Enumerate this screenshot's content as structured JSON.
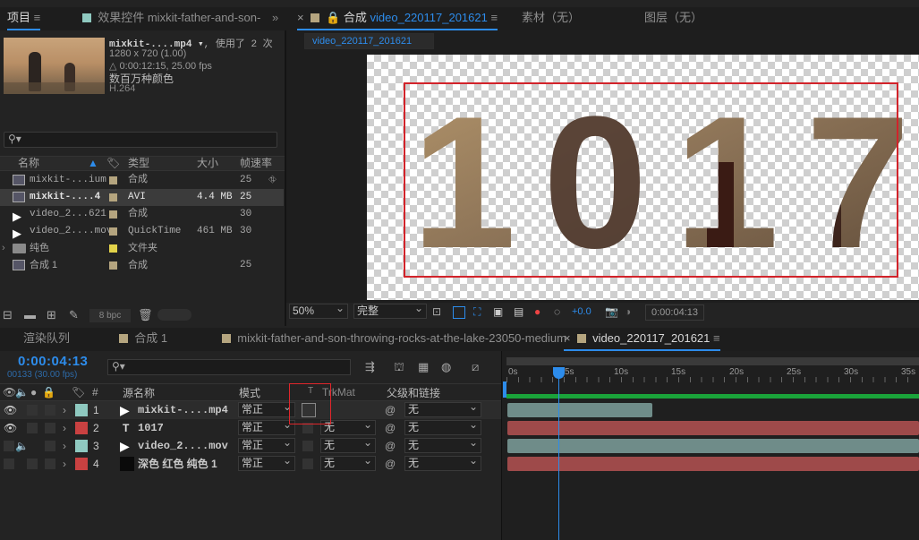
{
  "top_tabs": {
    "project": "项目",
    "effects": "效果控件 mixkit-father-and-son-",
    "comp_prefix": "合成",
    "comp_name": "video_220117_201621",
    "footage": "素材（无）",
    "layer": "图层（无）"
  },
  "project": {
    "thumb_name": "mixkit-....mp4 ▾",
    "used": ", 使用了 2 次",
    "resolution": "1280 x 720 (1.00)",
    "duration": "△ 0:00:12:15, 25.00 fps",
    "colors": "数百万种颜色",
    "codec": "H.264",
    "search_placeholder": "",
    "columns": {
      "name": "名称",
      "type": "类型",
      "size": "大小",
      "fps": "帧速率"
    },
    "items": [
      {
        "name": "mixkit-...ium",
        "type": "合成",
        "size": "",
        "fps": "25",
        "icon": "composition-icon",
        "color": "#b5a57f"
      },
      {
        "name": "mixkit-....4",
        "type": "AVI",
        "size": "4.4 MB",
        "fps": "25",
        "icon": "footage-icon",
        "color": "#b5a57f"
      },
      {
        "name": "video_2...621",
        "type": "合成",
        "size": "",
        "fps": "30",
        "icon": "composition-icon",
        "color": "#b5a57f"
      },
      {
        "name": "video_2....mov",
        "type": "QuickTime",
        "size": "461 MB",
        "fps": "30",
        "icon": "footage-icon",
        "color": "#b5a57f"
      },
      {
        "name": "纯色",
        "type": "文件夹",
        "size": "",
        "fps": "",
        "icon": "folder-icon",
        "color": "#e3d34a"
      },
      {
        "name": "合成 1",
        "type": "合成",
        "size": "",
        "fps": "25",
        "icon": "composition-icon",
        "color": "#b5a57f"
      }
    ],
    "bpc": "8 bpc"
  },
  "viewer": {
    "comp_chip": "video_220117_201621",
    "canvas_text": "1017",
    "zoom": "50%",
    "quality": "完整",
    "exposure": "+0.0",
    "timecode": "0:00:04:13"
  },
  "timeline_tabs": {
    "render_queue": "渲染队列",
    "comp1": "合成 1",
    "mixkit": "mixkit-father-and-son-throwing-rocks-at-the-lake-23050-medium",
    "active": "video_220117_201621"
  },
  "timeline": {
    "timecode": "0:00:04:13",
    "frames": "00133 (30.00 fps)",
    "headers": {
      "num": "#",
      "source": "源名称",
      "mode": "模式",
      "t": "T",
      "trkmat": "TrkMat",
      "parent": "父级和链接"
    },
    "layers": [
      {
        "num": "1",
        "name": "mixkit-....mp4",
        "mode": "常正",
        "trkmat": "",
        "parent": "无",
        "color": "#8fc9c0"
      },
      {
        "num": "2",
        "name": "1017",
        "mode": "常正",
        "trkmat": "无",
        "parent": "无",
        "color": "#c94141"
      },
      {
        "num": "3",
        "name": "video_2....mov",
        "mode": "常正",
        "trkmat": "无",
        "parent": "无",
        "color": "#8fc9c0"
      },
      {
        "num": "4",
        "name": "深色 红色 纯色 1",
        "mode": "常正",
        "trkmat": "无",
        "parent": "无",
        "color": "#c94141"
      }
    ],
    "ruler": [
      "0s",
      "5s",
      "10s",
      "15s",
      "20s",
      "25s",
      "30s",
      "35s"
    ],
    "bar_colors": {
      "teal": "#6f8c89",
      "red": "#9e4a4a",
      "work_area": "#1aa33a",
      "playhead": "#2d8ceb"
    }
  }
}
